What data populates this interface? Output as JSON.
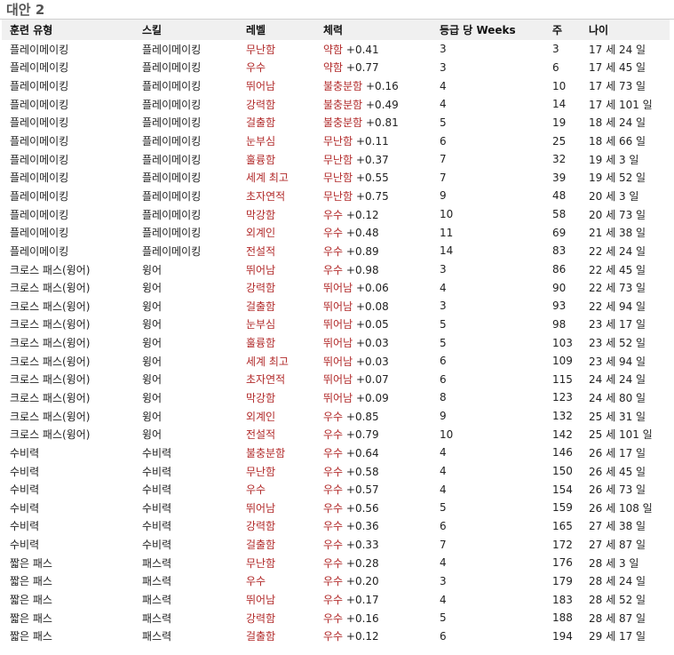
{
  "section_title": "대안 2",
  "headers": [
    "훈련 유형",
    "스킬",
    "레벨",
    "체력",
    "등급 당 Weeks",
    "주",
    "나이"
  ],
  "rows": [
    [
      "플레이메이킹",
      "플레이메이킹",
      "무난함",
      "약함",
      "+0.41",
      "3",
      "3",
      "17 세 24 일"
    ],
    [
      "플레이메이킹",
      "플레이메이킹",
      "우수",
      "약함",
      "+0.77",
      "3",
      "6",
      "17 세 45 일"
    ],
    [
      "플레이메이킹",
      "플레이메이킹",
      "뛰어남",
      "불충분함",
      "+0.16",
      "4",
      "10",
      "17 세 73 일"
    ],
    [
      "플레이메이킹",
      "플레이메이킹",
      "강력함",
      "불충분함",
      "+0.49",
      "4",
      "14",
      "17 세 101 일"
    ],
    [
      "플레이메이킹",
      "플레이메이킹",
      "걸출함",
      "불충분함",
      "+0.81",
      "5",
      "19",
      "18 세 24 일"
    ],
    [
      "플레이메이킹",
      "플레이메이킹",
      "눈부심",
      "무난함",
      "+0.11",
      "6",
      "25",
      "18 세 66 일"
    ],
    [
      "플레이메이킹",
      "플레이메이킹",
      "훌륭함",
      "무난함",
      "+0.37",
      "7",
      "32",
      "19 세 3 일"
    ],
    [
      "플레이메이킹",
      "플레이메이킹",
      "세계 최고",
      "무난함",
      "+0.55",
      "7",
      "39",
      "19 세 52 일"
    ],
    [
      "플레이메이킹",
      "플레이메이킹",
      "초자연적",
      "무난함",
      "+0.75",
      "9",
      "48",
      "20 세 3 일"
    ],
    [
      "플레이메이킹",
      "플레이메이킹",
      "막강함",
      "우수",
      "+0.12",
      "10",
      "58",
      "20 세 73 일"
    ],
    [
      "플레이메이킹",
      "플레이메이킹",
      "외계인",
      "우수",
      "+0.48",
      "11",
      "69",
      "21 세 38 일"
    ],
    [
      "플레이메이킹",
      "플레이메이킹",
      "전설적",
      "우수",
      "+0.89",
      "14",
      "83",
      "22 세 24 일"
    ],
    [
      "크로스 패스(윙어)",
      "윙어",
      "뛰어남",
      "우수",
      "+0.98",
      "3",
      "86",
      "22 세 45 일"
    ],
    [
      "크로스 패스(윙어)",
      "윙어",
      "강력함",
      "뛰어남",
      "+0.06",
      "4",
      "90",
      "22 세 73 일"
    ],
    [
      "크로스 패스(윙어)",
      "윙어",
      "걸출함",
      "뛰어남",
      "+0.08",
      "3",
      "93",
      "22 세 94 일"
    ],
    [
      "크로스 패스(윙어)",
      "윙어",
      "눈부심",
      "뛰어남",
      "+0.05",
      "5",
      "98",
      "23 세 17 일"
    ],
    [
      "크로스 패스(윙어)",
      "윙어",
      "훌륭함",
      "뛰어남",
      "+0.03",
      "5",
      "103",
      "23 세 52 일"
    ],
    [
      "크로스 패스(윙어)",
      "윙어",
      "세계 최고",
      "뛰어남",
      "+0.03",
      "6",
      "109",
      "23 세 94 일"
    ],
    [
      "크로스 패스(윙어)",
      "윙어",
      "초자연적",
      "뛰어남",
      "+0.07",
      "6",
      "115",
      "24 세 24 일"
    ],
    [
      "크로스 패스(윙어)",
      "윙어",
      "막강함",
      "뛰어남",
      "+0.09",
      "8",
      "123",
      "24 세 80 일"
    ],
    [
      "크로스 패스(윙어)",
      "윙어",
      "외계인",
      "우수",
      "+0.85",
      "9",
      "132",
      "25 세 31 일"
    ],
    [
      "크로스 패스(윙어)",
      "윙어",
      "전설적",
      "우수",
      "+0.79",
      "10",
      "142",
      "25 세 101 일"
    ],
    [
      "수비력",
      "수비력",
      "불충분함",
      "우수",
      "+0.64",
      "4",
      "146",
      "26 세 17 일"
    ],
    [
      "수비력",
      "수비력",
      "무난함",
      "우수",
      "+0.58",
      "4",
      "150",
      "26 세 45 일"
    ],
    [
      "수비력",
      "수비력",
      "우수",
      "우수",
      "+0.57",
      "4",
      "154",
      "26 세 73 일"
    ],
    [
      "수비력",
      "수비력",
      "뛰어남",
      "우수",
      "+0.56",
      "5",
      "159",
      "26 세 108 일"
    ],
    [
      "수비력",
      "수비력",
      "강력함",
      "우수",
      "+0.36",
      "6",
      "165",
      "27 세 38 일"
    ],
    [
      "수비력",
      "수비력",
      "걸출함",
      "우수",
      "+0.33",
      "7",
      "172",
      "27 세 87 일"
    ],
    [
      "짧은 패스",
      "패스력",
      "무난함",
      "우수",
      "+0.28",
      "4",
      "176",
      "28 세 3 일"
    ],
    [
      "짧은 패스",
      "패스력",
      "우수",
      "우수",
      "+0.20",
      "3",
      "179",
      "28 세 24 일"
    ],
    [
      "짧은 패스",
      "패스력",
      "뛰어남",
      "우수",
      "+0.17",
      "4",
      "183",
      "28 세 52 일"
    ],
    [
      "짧은 패스",
      "패스력",
      "강력함",
      "우수",
      "+0.16",
      "5",
      "188",
      "28 세 87 일"
    ],
    [
      "짧은 패스",
      "패스력",
      "걸출함",
      "우수",
      "+0.12",
      "6",
      "194",
      "29 세 17 일"
    ]
  ]
}
